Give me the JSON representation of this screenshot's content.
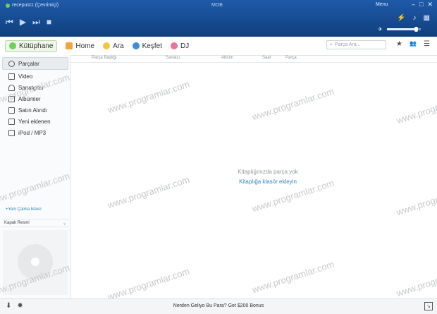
{
  "window": {
    "user": "recepust1 (Çevrimiçi)",
    "brand": "MOB",
    "menu_label": "Menu",
    "min_glyph": "–",
    "max_glyph": "□",
    "close_glyph": "✕"
  },
  "transport": {
    "prev": "⏮",
    "play": "▶",
    "next": "⏭",
    "stop": "■"
  },
  "right_controls": {
    "c1": "⚡",
    "c2": "♪",
    "c3": "▦",
    "vol_icon": "✈"
  },
  "volume_level": 0.85,
  "nav": {
    "library": "Kütüphane",
    "home": "Home",
    "search": "Ara",
    "discover": "Keşfet",
    "dj": "DJ"
  },
  "search_box": {
    "placeholder": "Parça Ara..."
  },
  "tool_glyphs": {
    "star": "★",
    "people": "👥",
    "list": "☰"
  },
  "sidebar": {
    "items": [
      {
        "label": "Parçalar",
        "icon": "circle-note-icon"
      },
      {
        "label": "Video",
        "icon": "tv-icon"
      },
      {
        "label": "Sanatçılar",
        "icon": "person-icon"
      },
      {
        "label": "Albümler",
        "icon": "album-icon"
      },
      {
        "label": "Satın Alındı",
        "icon": "cart-icon"
      },
      {
        "label": "Yeni eklenen",
        "icon": "new-icon"
      },
      {
        "label": "iPod / MP3",
        "icon": "ipod-icon"
      }
    ],
    "new_playlist": "+Yeni Çalma listesi",
    "cover_header": "Kapak Resmi",
    "cover_chevron": "⌄"
  },
  "columns": [
    "Parça Başlığı",
    "Sanatçı",
    "Albüm",
    "Saat",
    "Parça"
  ],
  "empty_state": {
    "message": "Kitaplığınızda parça yok",
    "link": "Kitaplığa klasör ekleyin"
  },
  "watermark": "www.programlar.com",
  "bottom": {
    "promo": "Nerden Geliyo Bu Para? Get $200 Bonus",
    "dl_glyph": "⬇",
    "app_glyph": "✹",
    "expand_glyph": "↘"
  },
  "colors": {
    "titlebar": "#154a8f",
    "accent_green": "#6fd05a",
    "link_blue": "#2f87c6"
  }
}
